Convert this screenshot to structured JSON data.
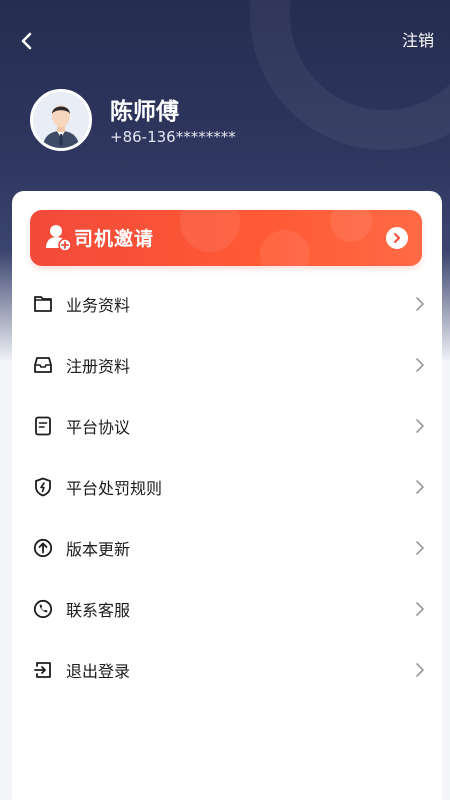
{
  "header": {
    "logout_label": "注销"
  },
  "profile": {
    "name": "陈师傅",
    "phone": "+86-136********"
  },
  "invite_banner": {
    "label": "司机邀请"
  },
  "menu": {
    "items": [
      {
        "label": "业务资料",
        "icon": "folder-icon"
      },
      {
        "label": "注册资料",
        "icon": "inbox-icon"
      },
      {
        "label": "平台协议",
        "icon": "document-icon"
      },
      {
        "label": "平台处罚规则",
        "icon": "shield-bolt-icon"
      },
      {
        "label": "版本更新",
        "icon": "upload-circle-icon"
      },
      {
        "label": "联系客服",
        "icon": "phone-icon"
      },
      {
        "label": "退出登录",
        "icon": "logout-icon"
      }
    ]
  },
  "colors": {
    "header_bg": "#262d52",
    "accent": "#f24a3a"
  }
}
